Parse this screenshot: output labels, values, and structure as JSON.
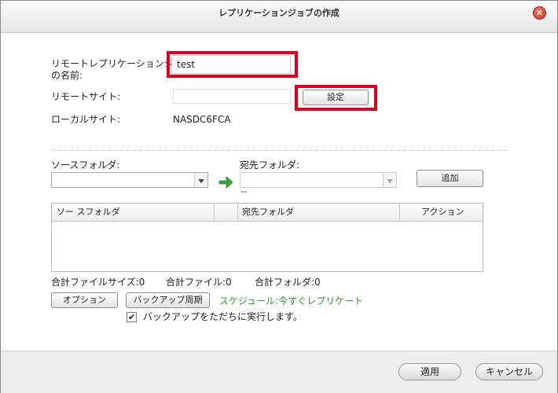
{
  "dialog": {
    "title": "レプリケーションジョブの作成",
    "close_glyph": "✕"
  },
  "form": {
    "job_name_label_line1": "リモートレプリケーションジョブ",
    "job_name_label_line2": "の名前:",
    "job_name_value": "test",
    "remote_site_label": "リモートサイト:",
    "remote_site_value": "",
    "settings_button": "設定",
    "local_site_label": "ローカルサイト:",
    "local_site_value": "NASDC6FCA"
  },
  "folders": {
    "source_label": "ソースフォルダ:",
    "source_value": "",
    "dest_label": "宛先フォルダ:",
    "dest_value": "",
    "dest_hint": "--",
    "add_button": "追加"
  },
  "table": {
    "columns": [
      "ソー スフォルダ",
      "",
      "宛先フォルダ",
      "アクション"
    ]
  },
  "totals": {
    "size": "合計ファイルサイズ:0",
    "files": "合計ファイル:0",
    "folders": "合計フォルダ:0"
  },
  "options_button": "オプション",
  "backup_schedule_button": "バックアップ周期",
  "schedule_text": "スケジュール:今すぐレプリケート",
  "run_now": {
    "label": "バックアップをただちに実行します。",
    "checked": true
  },
  "footer": {
    "apply_button": "適用",
    "cancel_button": "キャンセル"
  },
  "colors": {
    "highlight_red": "#e0001b",
    "schedule_green": "#2d9a2d",
    "arrow_green": "#3aa635",
    "close_red": "#c8321f"
  },
  "icons": {
    "close": "close-icon",
    "arrow": "arrow-right-icon",
    "checkbox": "checkmark-icon"
  }
}
